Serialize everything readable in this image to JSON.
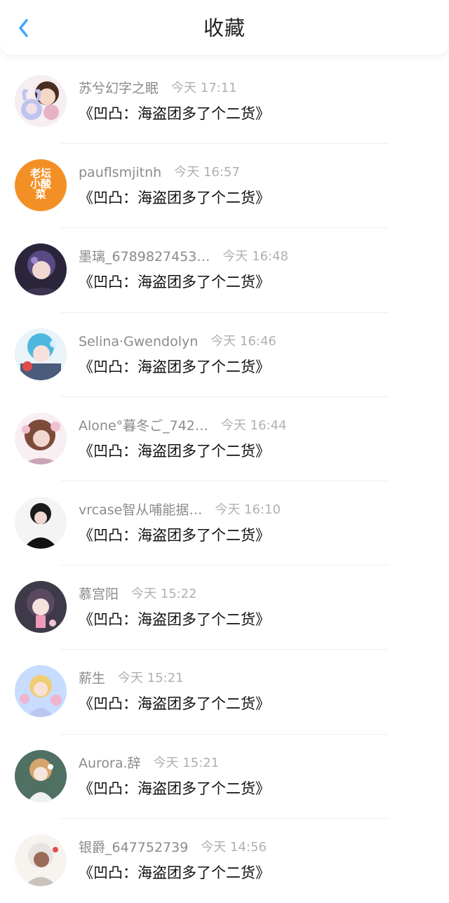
{
  "header": {
    "title": "收藏"
  },
  "items": [
    {
      "name": "苏兮幻字之眠",
      "time": "今天 17:11",
      "content": "《凹凸：海盗团多了个二货》"
    },
    {
      "name": "pauflsmjitnh",
      "time": "今天 16:57",
      "content": "《凹凸：海盗团多了个二货》"
    },
    {
      "name": "墨璃_6789827453…",
      "time": "今天 16:48",
      "content": "《凹凸：海盗团多了个二货》"
    },
    {
      "name": "Selina·Gwendolyn",
      "time": "今天 16:46",
      "content": "《凹凸：海盗团多了个二货》"
    },
    {
      "name": "Alone°暮冬ご_742…",
      "time": "今天 16:44",
      "content": "《凹凸：海盗团多了个二货》"
    },
    {
      "name": "vrcase智从哺能据…",
      "time": "今天 16:10",
      "content": "《凹凸：海盗团多了个二货》"
    },
    {
      "name": "慕宫阳",
      "time": "今天 15:22",
      "content": "《凹凸：海盗团多了个二货》"
    },
    {
      "name": "薪生",
      "time": "今天 15:21",
      "content": "《凹凸：海盗团多了个二货》"
    },
    {
      "name": "Aurora.辞",
      "time": "今天 15:21",
      "content": "《凹凸：海盗团多了个二货》"
    },
    {
      "name": "银爵_647752739",
      "time": "今天 14:56",
      "content": "《凹凸：海盗团多了个二货》"
    }
  ],
  "avatar_logo_text": "老坛\n小酸\n菜",
  "colors": {
    "accent": "#3ea7ff",
    "time": "#b0b0b0",
    "name": "#8b8b8b",
    "content": "#111111"
  }
}
